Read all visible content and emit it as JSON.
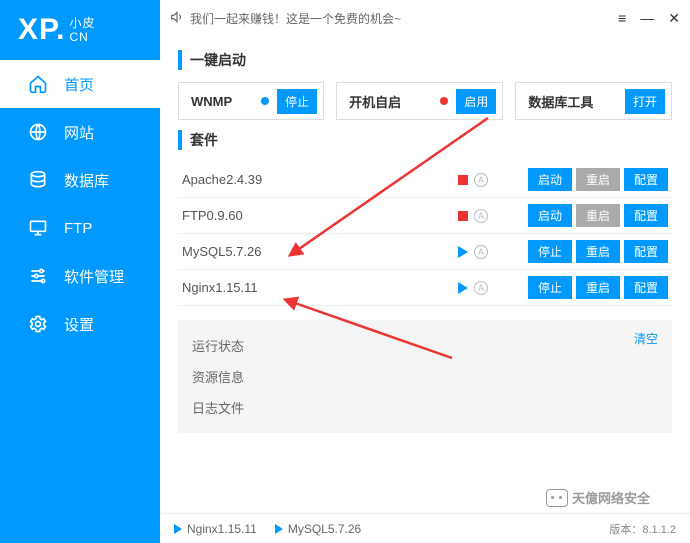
{
  "logo": {
    "big": "XP.",
    "small_top": "小皮",
    "small_bottom": "CN"
  },
  "nav": [
    {
      "key": "home",
      "label": "首页",
      "icon": "home-icon",
      "active": true
    },
    {
      "key": "site",
      "label": "网站",
      "icon": "globe-icon",
      "active": false
    },
    {
      "key": "db",
      "label": "数据库",
      "icon": "database-icon",
      "active": false
    },
    {
      "key": "ftp",
      "label": "FTP",
      "icon": "ftp-icon",
      "active": false
    },
    {
      "key": "soft",
      "label": "软件管理",
      "icon": "sliders-icon",
      "active": false
    },
    {
      "key": "setting",
      "label": "设置",
      "icon": "gear-icon",
      "active": false
    }
  ],
  "titlebar": {
    "announce": "我们一起来赚钱！这是一个免费的机会~"
  },
  "sections": {
    "quick": "一键启动",
    "kits": "套件"
  },
  "quick": {
    "wnmp_label": "WNMP",
    "wnmp_btn": "停止",
    "autostart_label": "开机自启",
    "autostart_btn": "启用",
    "dbtool_label": "数据库工具",
    "dbtool_btn": "打开"
  },
  "kits": [
    {
      "name": "Apache2.4.39",
      "running": false,
      "btns": [
        "启动",
        "重启",
        "配置"
      ],
      "disabled": [
        1
      ]
    },
    {
      "name": "FTP0.9.60",
      "running": false,
      "btns": [
        "启动",
        "重启",
        "配置"
      ],
      "disabled": [
        1
      ]
    },
    {
      "name": "MySQL5.7.26",
      "running": true,
      "btns": [
        "停止",
        "重启",
        "配置"
      ],
      "disabled": []
    },
    {
      "name": "Nginx1.15.11",
      "running": true,
      "btns": [
        "停止",
        "重启",
        "配置"
      ],
      "disabled": []
    }
  ],
  "panel": {
    "status": "运行状态",
    "resource": "资源信息",
    "logs": "日志文件",
    "clear": "清空"
  },
  "footer": {
    "items": [
      "Nginx1.15.11",
      "MySQL5.7.26"
    ],
    "version_label": "版本：",
    "version": "8.1.1.2"
  },
  "watermark": "天億网络安全"
}
